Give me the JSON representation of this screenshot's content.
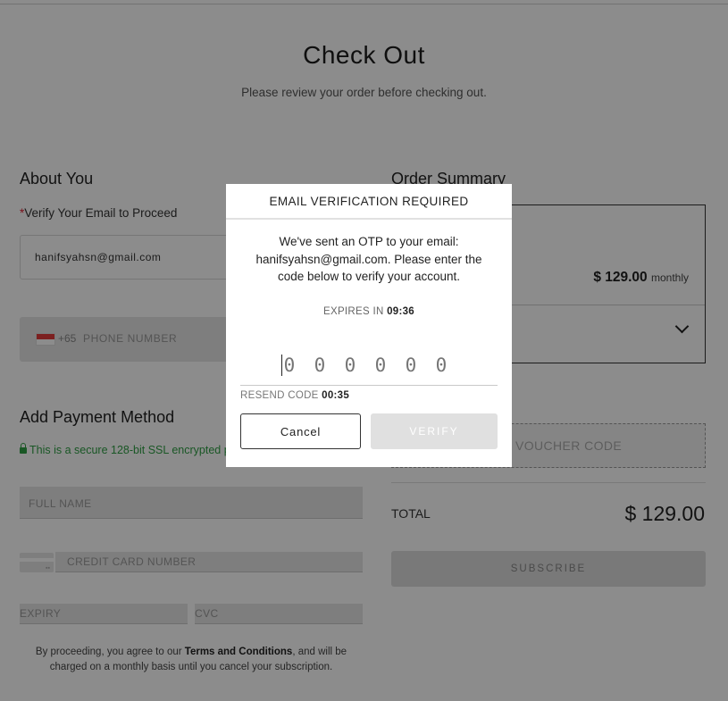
{
  "page": {
    "title": "Check Out",
    "subtitle": "Please review your order before checking out."
  },
  "about": {
    "heading": "About You",
    "verify_label": "Verify Your Email to Proceed",
    "required_mark": "*",
    "email_value": "hanifsyahsn@gmail.com",
    "dial_code": "+65",
    "phone_placeholder": "PHONE NUMBER"
  },
  "payment": {
    "heading": "Add Payment Method",
    "secure_text": "This is a secure 128-bit SSL encrypted p",
    "fullname_placeholder": "FULL NAME",
    "card_placeholder": "CREDIT CARD NUMBER",
    "expiry_placeholder": "EXPIRY",
    "cvc_placeholder": "CVC",
    "terms_pre": "By proceeding, you agree to our ",
    "terms_link": "Terms and Conditions",
    "terms_post": ", and will be charged on a monthly basis until you cancel your subscription."
  },
  "summary": {
    "heading": "Order Summary",
    "price": "$ 129.00",
    "period": "monthly",
    "voucher_placeholder": "VOUCHER CODE",
    "total_label": "TOTAL",
    "total_value": "$ 129.00",
    "subscribe_label": "SUBSCRIBE"
  },
  "modal": {
    "title": "EMAIL VERIFICATION REQUIRED",
    "body": "We've sent an OTP to your email: hanifsyahsn@gmail.com. Please enter the code below to verify your account.",
    "expires_label": "EXPIRES IN",
    "expires_time": "09:36",
    "otp_placeholders": [
      "0",
      "0",
      "0",
      "0",
      "0",
      "0"
    ],
    "resend_label": "RESEND CODE",
    "resend_time": "00:35",
    "cancel_label": "Cancel",
    "verify_label": "VERIFY"
  },
  "colors": {
    "secure_green": "#2f9e44",
    "required_red": "#dd2233",
    "overlay": "rgba(0,0,0,0.45)"
  }
}
